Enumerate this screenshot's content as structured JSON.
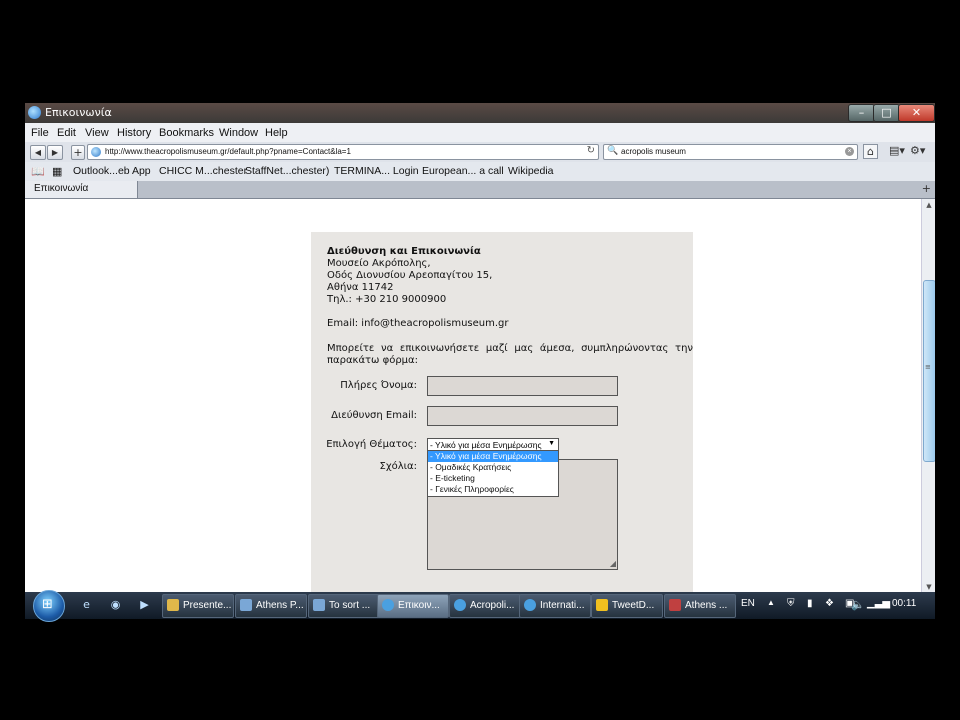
{
  "window": {
    "title": "Επικοινωνία"
  },
  "menu": [
    "File",
    "Edit",
    "View",
    "History",
    "Bookmarks",
    "Window",
    "Help"
  ],
  "nav": {
    "url": "http://www.theacropolismuseum.gr/default.php?pname=Contact&la=1",
    "search": "acropolis museum"
  },
  "bookmarks": [
    "Outlook...eb App",
    "CHICC M...chester",
    "StaffNet...chester)",
    "TERMINA... Login",
    "European... a call",
    "Wikipedia"
  ],
  "tab": {
    "label": "Επικοινωνία"
  },
  "page": {
    "address_heading": "Διεύθυνση και Επικοινωνία",
    "address_lines": [
      "Μουσείο Ακρόπολης,",
      "Οδός Διονυσίου Αρεοπαγίτου 15,",
      "Αθήνα 11742",
      "Τηλ.: +30 210 9000900"
    ],
    "email": "Email: info@theacropolismuseum.gr",
    "intro": "Μπορείτε να επικοινωνήσετε μαζί μας άμεσα, συμπληρώνοντας την παρακάτω φόρμα:",
    "form": {
      "name_label": "Πλήρες Όνομα:",
      "email_label": "Διεύθυνση Email:",
      "subject_label": "Επιλογή Θέματος:",
      "comments_label": "Σχόλια:",
      "subject_selected": "- Υλικό για μέσα Ενημέρωσης",
      "subject_options": [
        "- Υλικό για μέσα Ενημέρωσης",
        "- Ομαδικές Κρατήσεις",
        "- E-ticketing",
        "- Γενικές Πληροφορίες"
      ]
    }
  },
  "taskbar": {
    "buttons": [
      "Presente...",
      "Athens P...",
      "To sort ...",
      "Επικοιν...",
      "Acropoli...",
      "Internati...",
      "TweetD...",
      "Athens ..."
    ],
    "language": "EN",
    "clock": "00:11"
  }
}
